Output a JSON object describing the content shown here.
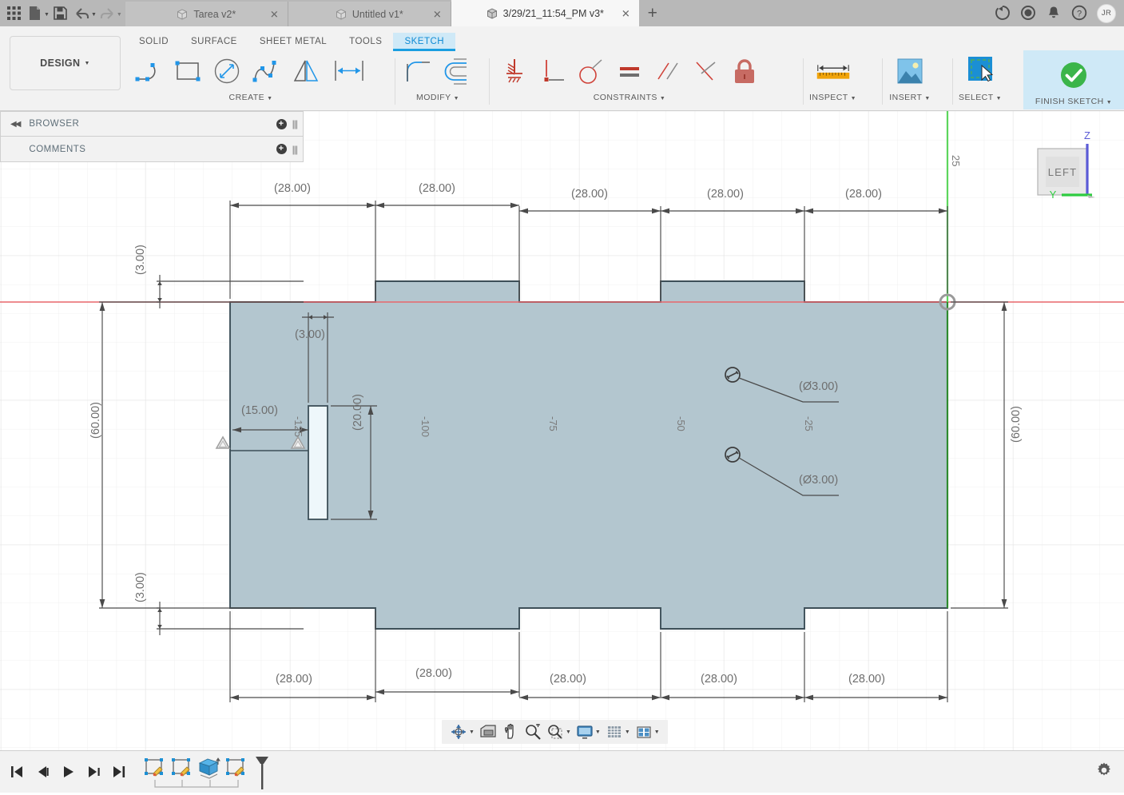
{
  "app": {
    "name": "Autodesk Fusion 360",
    "quick_access": [
      {
        "name": "app-grid-icon",
        "label": "Grid"
      },
      {
        "name": "new-file-icon",
        "label": "New"
      },
      {
        "name": "save-icon",
        "label": "Save"
      },
      {
        "name": "undo-icon",
        "label": "Undo"
      },
      {
        "name": "redo-icon",
        "label": "Redo"
      }
    ],
    "tabs": [
      {
        "label": "Tarea v2*",
        "active": false,
        "closable": true
      },
      {
        "label": "Untitled v1*",
        "active": false,
        "closable": true
      },
      {
        "label": "3/29/21_11:54_PM v3*",
        "active": true,
        "closable": true
      }
    ],
    "new_tab_label": "+",
    "right_icons": [
      {
        "name": "job-status-icon"
      },
      {
        "name": "recent-activity-icon"
      },
      {
        "name": "notifications-bell-icon"
      },
      {
        "name": "help-icon"
      }
    ],
    "avatar_initials": "JR"
  },
  "ribbon": {
    "workspace_button": "DESIGN",
    "workspace_tabs": [
      {
        "label": "SOLID",
        "active": false
      },
      {
        "label": "SURFACE",
        "active": false
      },
      {
        "label": "SHEET METAL",
        "active": false
      },
      {
        "label": "TOOLS",
        "active": false
      },
      {
        "label": "SKETCH",
        "active": true
      }
    ],
    "panels": [
      {
        "label": "CREATE",
        "has_caret": true,
        "tools": [
          {
            "name": "sketch-line-arc-icon",
            "label": "Line"
          },
          {
            "name": "sketch-rectangle-icon",
            "label": "Rectangle"
          },
          {
            "name": "sketch-circle-icon",
            "label": "Circle"
          },
          {
            "name": "sketch-spline-icon",
            "label": "Spline"
          },
          {
            "name": "sketch-mirror-icon",
            "label": "Mirror"
          },
          {
            "name": "sketch-dimension-icon",
            "label": "Sketch Dimension"
          }
        ]
      },
      {
        "label": "MODIFY",
        "has_caret": true,
        "tools": [
          {
            "name": "sketch-fillet-icon",
            "label": "Fillet"
          },
          {
            "name": "sketch-offset-icon",
            "label": "Offset"
          }
        ]
      },
      {
        "label": "CONSTRAINTS",
        "has_caret": true,
        "tools": [
          {
            "name": "constraint-fix-ground-icon",
            "label": "Fix/Unfix"
          },
          {
            "name": "constraint-coincident-icon",
            "label": "Coincident"
          },
          {
            "name": "constraint-tangent-icon",
            "label": "Tangent"
          },
          {
            "name": "constraint-equal-icon",
            "label": "Equal"
          },
          {
            "name": "constraint-parallel-icon",
            "label": "Parallel"
          },
          {
            "name": "constraint-perpendicular-icon",
            "label": "Perpendicular"
          },
          {
            "name": "constraint-lock-icon",
            "label": "Lock"
          }
        ]
      },
      {
        "label": "INSPECT",
        "has_caret": true,
        "tools": [
          {
            "name": "inspect-measure-icon",
            "label": "Measure"
          }
        ]
      },
      {
        "label": "INSERT",
        "has_caret": true,
        "tools": [
          {
            "name": "insert-image-icon",
            "label": "Insert Image"
          }
        ]
      },
      {
        "label": "SELECT",
        "has_caret": true,
        "active": true,
        "tools": [
          {
            "name": "select-window-icon",
            "label": "Select"
          }
        ]
      },
      {
        "label": "FINISH SKETCH",
        "has_caret": true,
        "highlighted": true,
        "tools": [
          {
            "name": "finish-sketch-check-icon",
            "label": "Finish Sketch"
          }
        ]
      }
    ]
  },
  "left_panels": [
    {
      "label": "BROWSER",
      "name": "browser-panel",
      "has_collapse_arrows": true
    },
    {
      "label": "COMMENTS",
      "name": "comments-panel",
      "has_collapse_arrows": false
    }
  ],
  "view_cube": {
    "face_label": "LEFT",
    "axis_labels": [
      {
        "label": "Z",
        "color": "#5b5bd6"
      },
      {
        "label": "Y",
        "color": "#2ecc40"
      }
    ]
  },
  "canvas": {
    "colors": {
      "sketch_fill": "#b3c6cf",
      "sketch_profile_line": "#3d4f58",
      "x_axis": "#e8666b",
      "z_axis": "#5cd65c",
      "dimension": "#6e6e6e",
      "grid_minor": "#f2f2f2",
      "grid_major": "#e3e3e3",
      "slot_fill": "#eef7fb",
      "origin_marker": "#9a9a9a"
    },
    "axis_tick_labels": [
      "-125",
      "-100",
      "-75",
      "-50",
      "-25",
      "25"
    ],
    "dimensions_top": [
      "(28.00)",
      "(28.00)",
      "(28.00)",
      "(28.00)",
      "(28.00)"
    ],
    "dimensions_bottom": [
      "(28.00)",
      "(28.00)",
      "(28.00)",
      "(28.00)",
      "(28.00)"
    ],
    "dimension_left_height": "(60.00)",
    "dimension_right_height": "(60.00)",
    "dimension_top_tab": "(3.00)",
    "dimension_bottom_tab": "(3.00)",
    "dimension_slot_width": "(3.00)",
    "dimension_slot_offset": "(15.00)",
    "dimension_slot_height": "(20.00)",
    "hole_callouts": [
      "(Ø3.00)",
      "(Ø3.00)"
    ],
    "constraint_glyphs": [
      {
        "name": "midpoint-constraint-glyph"
      },
      {
        "name": "midpoint-constraint-glyph"
      }
    ]
  },
  "nav_bar": [
    {
      "name": "orbit-icon",
      "label": "Orbit",
      "has_caret": true
    },
    {
      "name": "look-at-icon",
      "label": "Look At",
      "has_caret": false
    },
    {
      "name": "pan-icon",
      "label": "Pan",
      "has_caret": false
    },
    {
      "name": "zoom-icon",
      "label": "Zoom",
      "has_caret": false
    },
    {
      "name": "fit-icon",
      "label": "Fit",
      "has_caret": true
    },
    {
      "name": "display-settings-icon",
      "label": "Display Settings",
      "has_caret": true
    },
    {
      "name": "grid-snaps-icon",
      "label": "Grid and Snaps",
      "has_caret": true
    },
    {
      "name": "viewports-icon",
      "label": "Viewports",
      "has_caret": true
    }
  ],
  "timeline": {
    "playback": [
      {
        "name": "go-to-beginning-button",
        "label": "Go to beginning"
      },
      {
        "name": "step-back-button",
        "label": "Step back"
      },
      {
        "name": "play-button",
        "label": "Play"
      },
      {
        "name": "step-forward-button",
        "label": "Step forward"
      },
      {
        "name": "go-to-end-button",
        "label": "Go to end"
      }
    ],
    "features": [
      {
        "name": "timeline-sketch-feature",
        "label": "Sketch1",
        "type": "sketch"
      },
      {
        "name": "timeline-sketch-feature",
        "label": "Sketch2",
        "type": "sketch"
      },
      {
        "name": "timeline-extrude-feature",
        "label": "Extrude1",
        "type": "extrude"
      },
      {
        "name": "timeline-sketch-feature",
        "label": "Sketch3",
        "type": "sketch"
      }
    ],
    "marker_name": "timeline-end-marker",
    "settings_name": "timeline-settings-gear-icon"
  }
}
